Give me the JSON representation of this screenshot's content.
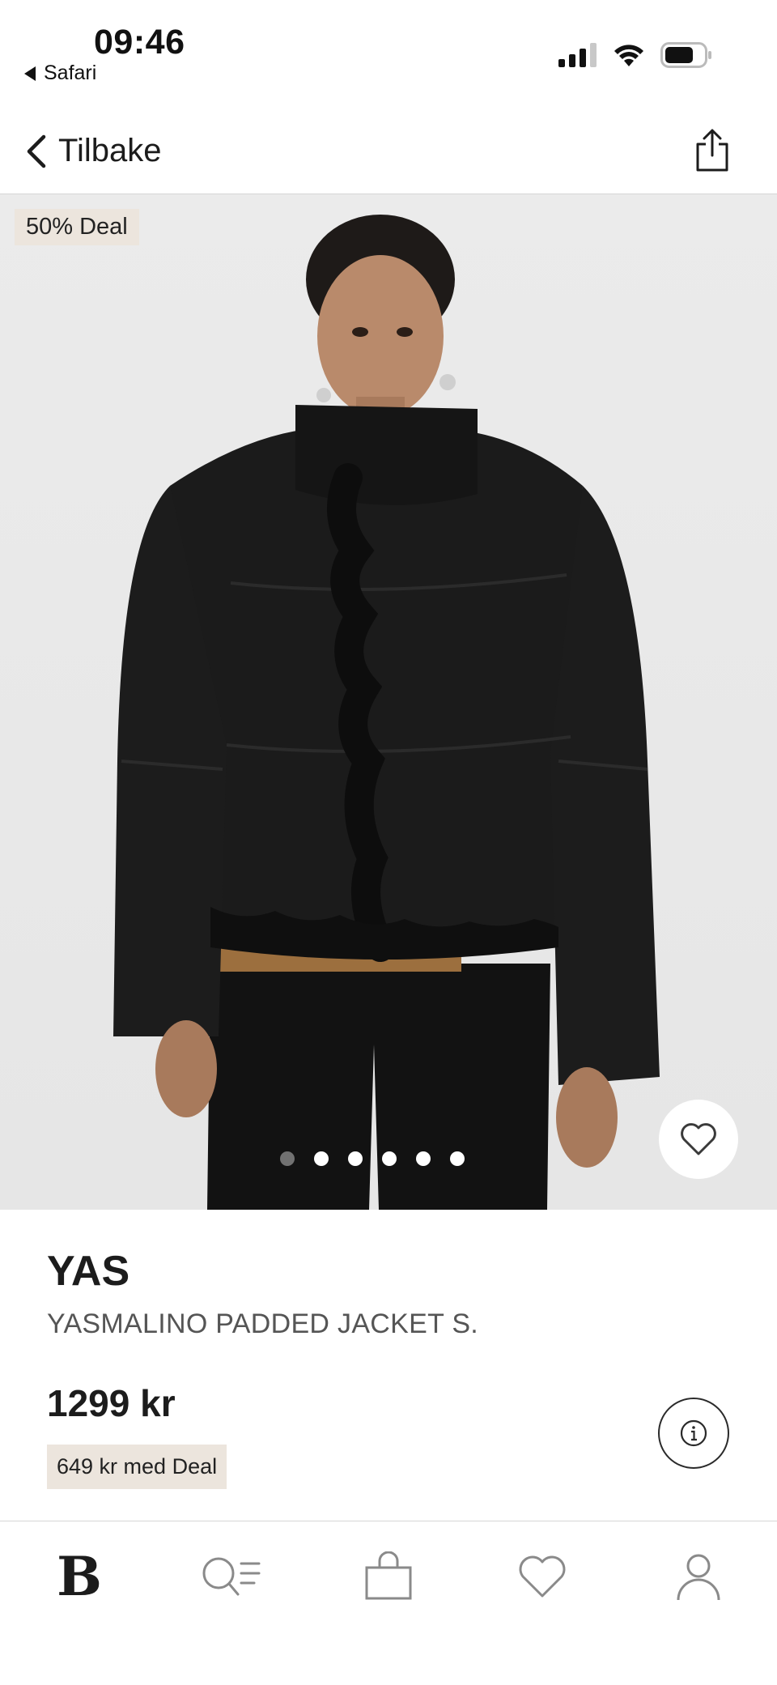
{
  "status_bar": {
    "time": "09:46",
    "back_app": "Safari",
    "icons": [
      "cellular-signal-icon",
      "wifi-icon",
      "battery-icon"
    ]
  },
  "nav": {
    "back_label": "Tilbake",
    "share_icon": "share-icon"
  },
  "hero": {
    "badge": "50% Deal",
    "image_count": 6,
    "active_index": 0
  },
  "product": {
    "brand": "YAS",
    "name": "YASMALINO PADDED JACKET S.",
    "price": "1299 kr",
    "deal_price": "649 kr med Deal"
  },
  "tabbar": {
    "logo": "B",
    "items": [
      "home-logo",
      "search-icon",
      "bag-icon",
      "heart-icon",
      "profile-icon"
    ]
  },
  "colors": {
    "deal_bg": "#ece5dd",
    "text": "#1c1c1c",
    "muted": "#555555",
    "image_bg": "#e8e8e8"
  }
}
